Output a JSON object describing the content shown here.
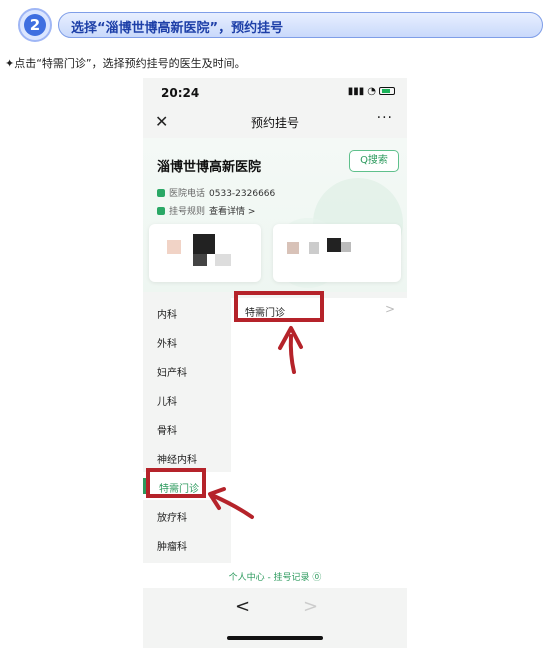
{
  "step": {
    "number": "2",
    "title": "选择“淄博世博高新医院”，预约挂号"
  },
  "instruction": "✦点击“特需门诊”，选择预约挂号的医生及时间。",
  "colors": {
    "accent_green": "#2c9a5d",
    "annotation_red": "#b5232a",
    "step_blue": "#3f6fe0"
  },
  "phone": {
    "status_bar": {
      "time": "20:24"
    },
    "nav": {
      "close_icon": "close-icon",
      "title": "预约挂号",
      "more": "···"
    },
    "hospital": {
      "name": "淄博世博高新医院",
      "search_label": "Q搜索",
      "phone_label": "医院电话",
      "phone_value": "0533-2326666",
      "rules_label": "挂号规则",
      "rules_link": "查看详情 >"
    },
    "departments": [
      {
        "label": "内科",
        "active": false
      },
      {
        "label": "外科",
        "active": false
      },
      {
        "label": "妇产科",
        "active": false
      },
      {
        "label": "儿科",
        "active": false
      },
      {
        "label": "骨科",
        "active": false
      },
      {
        "label": "神经内科",
        "active": false
      },
      {
        "label": "特需门诊",
        "active": true
      },
      {
        "label": "放疗科",
        "active": false
      },
      {
        "label": "肿瘤科",
        "active": false
      }
    ],
    "sub_panel": {
      "item": "特需门诊",
      "chevron": ">"
    },
    "footer_link": "个人中心 - 挂号记录 ⓪",
    "bottom_nav": {
      "back": "<",
      "forward": ">"
    }
  }
}
